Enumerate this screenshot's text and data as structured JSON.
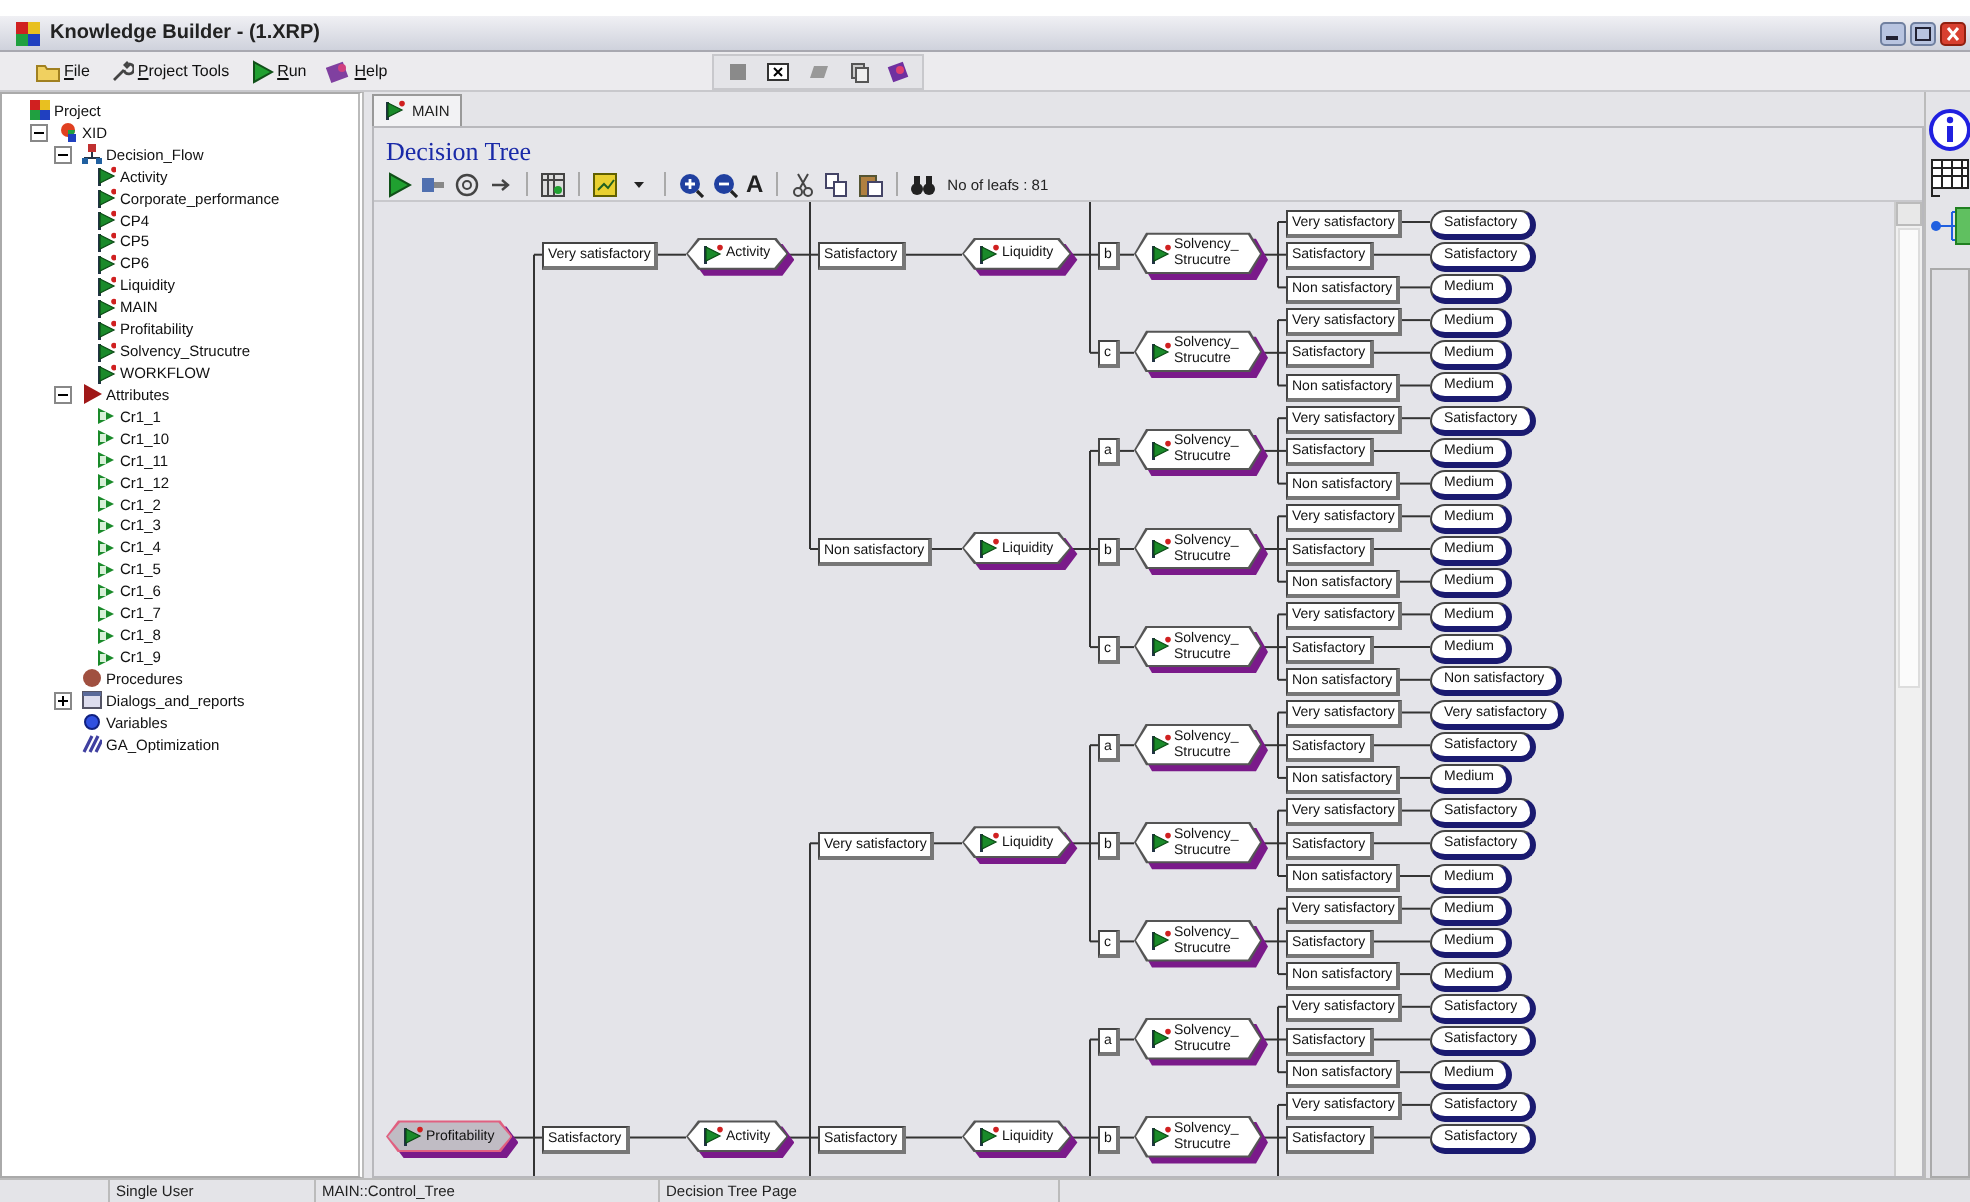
{
  "window": {
    "title": "Knowledge Builder - (1.XRP)"
  },
  "menu": [
    "File",
    "Project Tools",
    "Run",
    "Help"
  ],
  "project_tree": [
    {
      "label": "Project",
      "kind": "project",
      "children": [
        {
          "label": "XID",
          "kind": "xid",
          "expanded": true,
          "children": [
            {
              "label": "Decision_Flow",
              "kind": "flow",
              "expanded": true,
              "children": [
                {
                  "label": "Activity",
                  "kind": "flow_item"
                },
                {
                  "label": "Corporate_performance",
                  "kind": "flow_item"
                },
                {
                  "label": "CP4",
                  "kind": "flow_item"
                },
                {
                  "label": "CP5",
                  "kind": "flow_item"
                },
                {
                  "label": "CP6",
                  "kind": "flow_item"
                },
                {
                  "label": "Liquidity",
                  "kind": "flow_item"
                },
                {
                  "label": "MAIN",
                  "kind": "flow_item"
                },
                {
                  "label": "Profitability",
                  "kind": "flow_item"
                },
                {
                  "label": "Solvency_Strucutre",
                  "kind": "flow_item"
                },
                {
                  "label": "WORKFLOW",
                  "kind": "flow_item"
                }
              ]
            },
            {
              "label": "Attributes",
              "kind": "attributes",
              "expanded": true,
              "children": [
                {
                  "label": "Cr1_1",
                  "kind": "attribute"
                },
                {
                  "label": "Cr1_10",
                  "kind": "attribute"
                },
                {
                  "label": "Cr1_11",
                  "kind": "attribute"
                },
                {
                  "label": "Cr1_12",
                  "kind": "attribute"
                },
                {
                  "label": "Cr1_2",
                  "kind": "attribute"
                },
                {
                  "label": "Cr1_3",
                  "kind": "attribute"
                },
                {
                  "label": "Cr1_4",
                  "kind": "attribute"
                },
                {
                  "label": "Cr1_5",
                  "kind": "attribute"
                },
                {
                  "label": "Cr1_6",
                  "kind": "attribute"
                },
                {
                  "label": "Cr1_7",
                  "kind": "attribute"
                },
                {
                  "label": "Cr1_8",
                  "kind": "attribute"
                },
                {
                  "label": "Cr1_9",
                  "kind": "attribute"
                }
              ]
            },
            {
              "label": "Procedures",
              "kind": "procedures"
            },
            {
              "label": "Dialogs_and_reports",
              "kind": "dialogs",
              "expanded": false
            },
            {
              "label": "Variables",
              "kind": "variables"
            },
            {
              "label": "GA_Optimization",
              "kind": "ga"
            }
          ]
        }
      ]
    }
  ],
  "tabs": [
    {
      "label": "MAIN",
      "selected": true
    }
  ],
  "page_title": "Decision Tree",
  "toolbar": {
    "font_button": "A",
    "leaf_count": "No of leafs : 81"
  },
  "tree": {
    "kind": "attribute",
    "label": "Profitability",
    "selected": true,
    "hidden_below": true,
    "branches": [
      {
        "label": "Very satisfactory",
        "node": {
          "kind": "attribute",
          "label": "Activity",
          "selected": false,
          "hidden_above": true,
          "branches": [
            {
              "label": "Satisfactory",
              "node": {
                "kind": "attribute",
                "label": "Liquidity",
                "selected": false,
                "hidden_above": true,
                "branches": [
                  {
                    "label": "b",
                    "node": {
                      "kind": "attribute",
                      "label": "Solvency_Strucutre",
                      "selected": false,
                      "branches": [
                        {
                          "label": "Very satisfactory",
                          "node": {
                            "kind": "leaf",
                            "label": "Satisfactory"
                          }
                        },
                        {
                          "label": "Satisfactory",
                          "node": {
                            "kind": "leaf",
                            "label": "Satisfactory"
                          }
                        },
                        {
                          "label": "Non satisfactory",
                          "node": {
                            "kind": "leaf",
                            "label": "Medium"
                          }
                        }
                      ]
                    }
                  },
                  {
                    "label": "c",
                    "node": {
                      "kind": "attribute",
                      "label": "Solvency_Strucutre",
                      "selected": false,
                      "branches": [
                        {
                          "label": "Very satisfactory",
                          "node": {
                            "kind": "leaf",
                            "label": "Medium"
                          }
                        },
                        {
                          "label": "Satisfactory",
                          "node": {
                            "kind": "leaf",
                            "label": "Medium"
                          }
                        },
                        {
                          "label": "Non satisfactory",
                          "node": {
                            "kind": "leaf",
                            "label": "Medium"
                          }
                        }
                      ]
                    }
                  }
                ]
              }
            },
            {
              "label": "Non satisfactory",
              "node": {
                "kind": "attribute",
                "label": "Liquidity",
                "selected": false,
                "branches": [
                  {
                    "label": "a",
                    "node": {
                      "kind": "attribute",
                      "label": "Solvency_Strucutre",
                      "selected": false,
                      "branches": [
                        {
                          "label": "Very satisfactory",
                          "node": {
                            "kind": "leaf",
                            "label": "Satisfactory"
                          }
                        },
                        {
                          "label": "Satisfactory",
                          "node": {
                            "kind": "leaf",
                            "label": "Medium"
                          }
                        },
                        {
                          "label": "Non satisfactory",
                          "node": {
                            "kind": "leaf",
                            "label": "Medium"
                          }
                        }
                      ]
                    }
                  },
                  {
                    "label": "b",
                    "node": {
                      "kind": "attribute",
                      "label": "Solvency_Strucutre",
                      "selected": false,
                      "branches": [
                        {
                          "label": "Very satisfactory",
                          "node": {
                            "kind": "leaf",
                            "label": "Medium"
                          }
                        },
                        {
                          "label": "Satisfactory",
                          "node": {
                            "kind": "leaf",
                            "label": "Medium"
                          }
                        },
                        {
                          "label": "Non satisfactory",
                          "node": {
                            "kind": "leaf",
                            "label": "Medium"
                          }
                        }
                      ]
                    }
                  },
                  {
                    "label": "c",
                    "node": {
                      "kind": "attribute",
                      "label": "Solvency_Strucutre",
                      "selected": false,
                      "branches": [
                        {
                          "label": "Very satisfactory",
                          "node": {
                            "kind": "leaf",
                            "label": "Medium"
                          }
                        },
                        {
                          "label": "Satisfactory",
                          "node": {
                            "kind": "leaf",
                            "label": "Medium"
                          }
                        },
                        {
                          "label": "Non satisfactory",
                          "node": {
                            "kind": "leaf",
                            "label": "Non satisfactory"
                          }
                        }
                      ]
                    }
                  }
                ]
              }
            }
          ]
        }
      },
      {
        "label": "Satisfactory",
        "node": {
          "kind": "attribute",
          "label": "Activity",
          "selected": false,
          "hidden_below": true,
          "branches": [
            {
              "label": "Very satisfactory",
              "node": {
                "kind": "attribute",
                "label": "Liquidity",
                "selected": false,
                "branches": [
                  {
                    "label": "a",
                    "node": {
                      "kind": "attribute",
                      "label": "Solvency_Strucutre",
                      "selected": false,
                      "branches": [
                        {
                          "label": "Very satisfactory",
                          "node": {
                            "kind": "leaf",
                            "label": "Very satisfactory"
                          }
                        },
                        {
                          "label": "Satisfactory",
                          "node": {
                            "kind": "leaf",
                            "label": "Satisfactory"
                          }
                        },
                        {
                          "label": "Non satisfactory",
                          "node": {
                            "kind": "leaf",
                            "label": "Medium"
                          }
                        }
                      ]
                    }
                  },
                  {
                    "label": "b",
                    "node": {
                      "kind": "attribute",
                      "label": "Solvency_Strucutre",
                      "selected": false,
                      "branches": [
                        {
                          "label": "Very satisfactory",
                          "node": {
                            "kind": "leaf",
                            "label": "Satisfactory"
                          }
                        },
                        {
                          "label": "Satisfactory",
                          "node": {
                            "kind": "leaf",
                            "label": "Satisfactory"
                          }
                        },
                        {
                          "label": "Non satisfactory",
                          "node": {
                            "kind": "leaf",
                            "label": "Medium"
                          }
                        }
                      ]
                    }
                  },
                  {
                    "label": "c",
                    "node": {
                      "kind": "attribute",
                      "label": "Solvency_Strucutre",
                      "selected": false,
                      "branches": [
                        {
                          "label": "Very satisfactory",
                          "node": {
                            "kind": "leaf",
                            "label": "Medium"
                          }
                        },
                        {
                          "label": "Satisfactory",
                          "node": {
                            "kind": "leaf",
                            "label": "Medium"
                          }
                        },
                        {
                          "label": "Non satisfactory",
                          "node": {
                            "kind": "leaf",
                            "label": "Medium"
                          }
                        }
                      ]
                    }
                  }
                ]
              }
            },
            {
              "label": "Satisfactory",
              "node": {
                "kind": "attribute",
                "label": "Liquidity",
                "selected": false,
                "hidden_below": true,
                "branches": [
                  {
                    "label": "a",
                    "node": {
                      "kind": "attribute",
                      "label": "Solvency_Strucutre",
                      "selected": false,
                      "branches": [
                        {
                          "label": "Very satisfactory",
                          "node": {
                            "kind": "leaf",
                            "label": "Satisfactory"
                          }
                        },
                        {
                          "label": "Satisfactory",
                          "node": {
                            "kind": "leaf",
                            "label": "Satisfactory"
                          }
                        },
                        {
                          "label": "Non satisfactory",
                          "node": {
                            "kind": "leaf",
                            "label": "Medium"
                          }
                        }
                      ]
                    }
                  },
                  {
                    "label": "b",
                    "node": {
                      "kind": "attribute",
                      "label": "Solvency_Strucutre",
                      "selected": false,
                      "hidden_below": true,
                      "branches": [
                        {
                          "label": "Very satisfactory",
                          "node": {
                            "kind": "leaf",
                            "label": "Satisfactory"
                          }
                        },
                        {
                          "label": "Satisfactory",
                          "node": {
                            "kind": "leaf",
                            "label": "Satisfactory"
                          }
                        }
                      ]
                    }
                  }
                ]
              }
            }
          ]
        }
      }
    ]
  },
  "status_bar": [
    "Single User",
    "MAIN::Control_Tree",
    "Decision Tree Page"
  ]
}
